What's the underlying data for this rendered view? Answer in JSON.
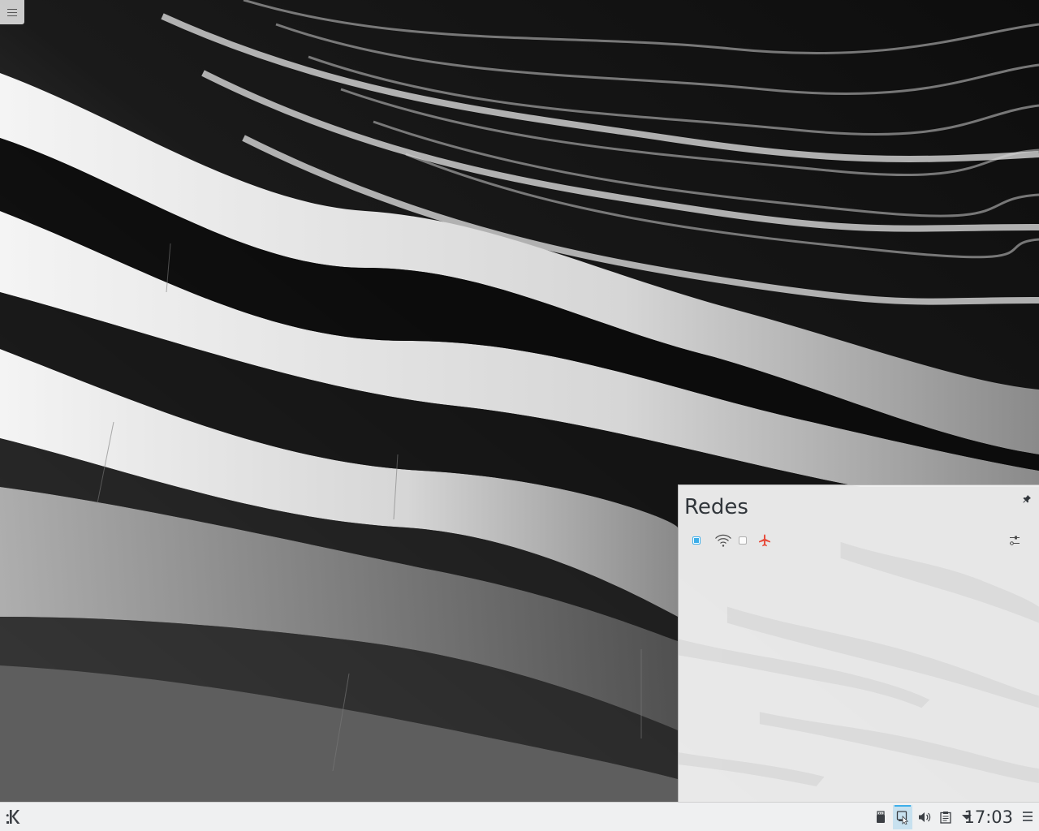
{
  "popup": {
    "title": "Redes",
    "icons": {
      "pin": "pin-icon",
      "ethernet_toggle": "checkbox-checked-icon",
      "wifi": "wifi-icon",
      "wifi_toggle": "checkbox-unchecked-icon",
      "airplane": "airplane-mode-icon",
      "configure": "configure-sliders-icon"
    },
    "ethernet_enabled": true,
    "wifi_enabled": false
  },
  "panel": {
    "clock": "17:03",
    "tray_icons": [
      "usb-device-icon",
      "network-icon",
      "volume-icon",
      "clipboard-icon",
      "expand-arrow-icon"
    ],
    "launcher_icon": "kde-logo-icon"
  },
  "colors": {
    "accent": "#3daee9",
    "airplane": "#e74c3c",
    "panel_bg": "#eff0f1",
    "text": "#31363b"
  }
}
